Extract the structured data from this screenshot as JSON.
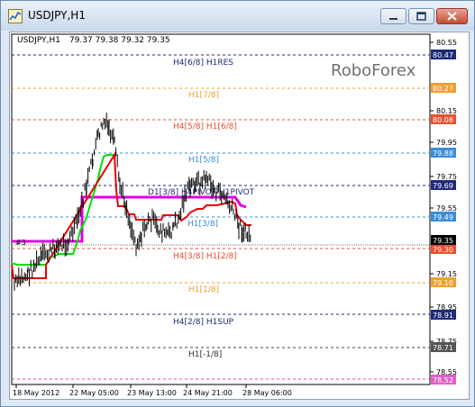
{
  "window": {
    "title": "USDJPY,H1"
  },
  "ohlc_header": {
    "symbol": "USDJPY,H1",
    "values": "79.37 79.38 79.32 79.35"
  },
  "watermark": "RoboForex",
  "price_axis": {
    "ticks": [
      "80.55",
      "80.15",
      "79.95",
      "79.75",
      "79.55",
      "79.15",
      "78.95",
      "78.75",
      "78.55"
    ]
  },
  "levels": [
    {
      "label": "H4[6/8] H1RES",
      "price": "80.47",
      "color": "#1e2a78",
      "tag_bg": "#1e2a78",
      "dash": "3,3"
    },
    {
      "label": "H1[7/8]",
      "price": "80.27",
      "color": "#f0a030",
      "tag_bg": "#f0a030",
      "dash": "3,3"
    },
    {
      "label": "H4[5/8] H1[6/8]",
      "price": "80.08",
      "color": "#e85030",
      "tag_bg": "#e85030",
      "dash": "3,3"
    },
    {
      "label": "H1[5/8]",
      "price": "79.88",
      "color": "#3a8cd8",
      "tag_bg": "#3a8cd8",
      "dash": "3,3"
    },
    {
      "label": "D1[3/8] H4PIVOT H1PIVOT",
      "price": "79.69",
      "color": "#1e2a78",
      "tag_bg": "#1e2a78",
      "dash": "3,3"
    },
    {
      "label": "H1[3/8]",
      "price": "79.49",
      "color": "#3a8cd8",
      "tag_bg": "#3a8cd8",
      "dash": "3,3"
    },
    {
      "label": "H4[3/8] H1[2/8]",
      "price": "79.30",
      "color": "#e85030",
      "tag_bg": "#e85030",
      "dash": "3,3"
    },
    {
      "label": "H1[1/8]",
      "price": "79.10",
      "color": "#f0a030",
      "tag_bg": "#f0a030",
      "dash": "3,3"
    },
    {
      "label": "H4[2/8] H1SUP",
      "price": "78.91",
      "color": "#1e2a78",
      "tag_bg": "#1e2a78",
      "dash": "3,3"
    },
    {
      "label": "H1[-1/8]",
      "price": "78.71",
      "color": "#444444",
      "tag_bg": "#555555",
      "dash": "3,3"
    },
    {
      "label": "",
      "price": "78.52",
      "color": "#e040c0",
      "tag_bg": "#e060c8",
      "dash": "3,3"
    }
  ],
  "current_price": "79.35",
  "time_axis": [
    "18 May 2012",
    "22 May 05:00",
    "23 May 13:00",
    "24 May 21:00",
    "28 May 06:00"
  ],
  "indicator_label": "#3",
  "colors": {
    "candles": "#000000",
    "ma_green": "#00e000",
    "ma_red": "#e80000",
    "pivot_magenta": "#e000e0"
  }
}
